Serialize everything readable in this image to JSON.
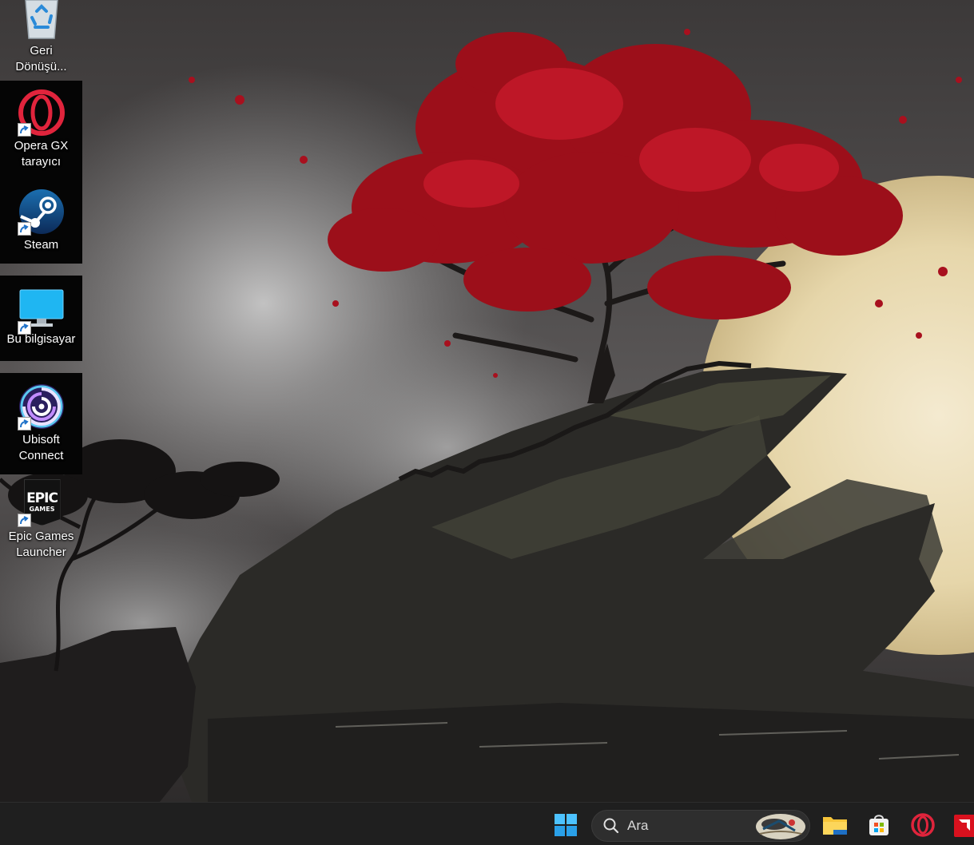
{
  "desktop": {
    "icons": [
      {
        "id": "recycle-bin",
        "label": "Geri\nDönüşü...",
        "line1": "Geri",
        "line2": "Dönüşü...",
        "selected": false,
        "shortcut": false
      },
      {
        "id": "opera-gx",
        "line1": "Opera GX",
        "line2": "tarayıcı",
        "selected": true,
        "shortcut": true
      },
      {
        "id": "steam",
        "line1": "Steam",
        "line2": "",
        "selected": true,
        "shortcut": true
      },
      {
        "id": "this-pc",
        "line1": "Bu bilgisayar",
        "line2": "",
        "selected": true,
        "shortcut": true
      },
      {
        "id": "ubisoft-connect",
        "line1": "Ubisoft",
        "line2": "Connect",
        "selected": true,
        "shortcut": true
      },
      {
        "id": "epic-games",
        "line1": "Epic Games",
        "line2": "Launcher",
        "selected": false,
        "shortcut": true,
        "logo_top": "EPIC",
        "logo_bottom": "GAMES"
      }
    ]
  },
  "taskbar": {
    "start_icon": "windows-logo-icon",
    "search": {
      "placeholder": "Ara",
      "icon": "search-icon"
    },
    "pinned": [
      {
        "id": "file-explorer",
        "icon": "folder-icon"
      },
      {
        "id": "microsoft-store",
        "icon": "store-icon"
      },
      {
        "id": "opera",
        "icon": "opera-icon"
      },
      {
        "id": "amd",
        "icon": "amd-icon"
      }
    ]
  },
  "colors": {
    "taskbar": "#1f1f1f",
    "accent_red": "#b01420",
    "selection": "#050505"
  }
}
